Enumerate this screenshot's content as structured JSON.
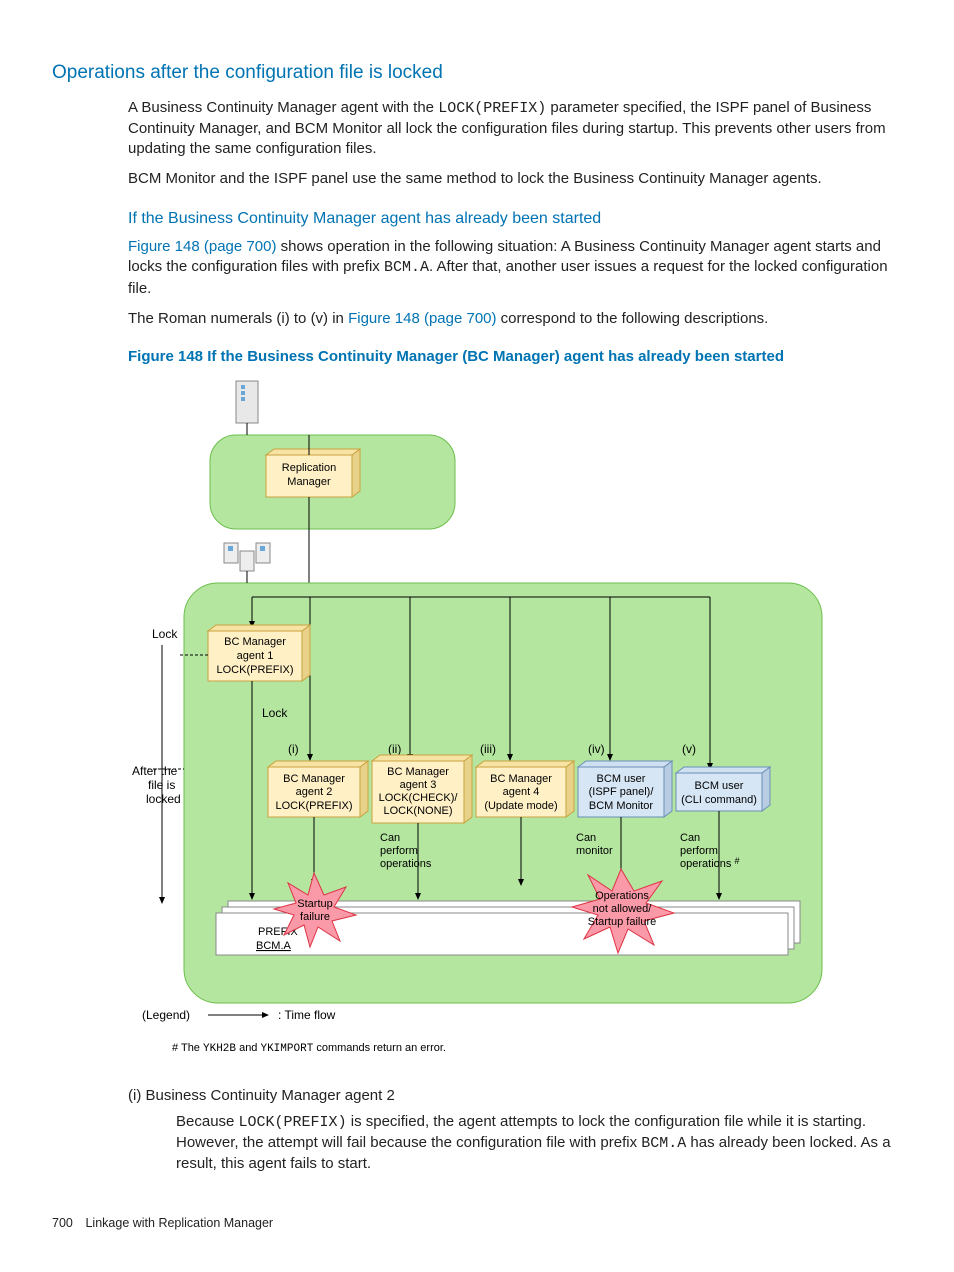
{
  "h2": "Operations after the configuration file is locked",
  "p1_a": "A Business Continuity Manager agent with the ",
  "p1_code": "LOCK(PREFIX)",
  "p1_b": " parameter specified, the ISPF panel of Business Continuity Manager, and BCM Monitor all lock the configuration files during startup. This prevents other users from updating the same configuration files.",
  "p2": "BCM Monitor and the ISPF panel use the same method to lock the Business Continuity Manager agents.",
  "h3": "If the Business Continuity Manager agent has already been started",
  "p3_link": "Figure 148 (page 700)",
  "p3_a": " shows operation in the following situation: A Business Continuity Manager agent starts and locks the configuration files with prefix ",
  "p3_code": "BCM.A",
  "p3_b": ". After that, another user issues a request for the locked configuration file.",
  "p4_a": "The Roman numerals (i) to (v) in ",
  "p4_link": "Figure 148 (page 700)",
  "p4_b": " correspond to the following descriptions.",
  "fig_caption": "Figure 148 If the Business Continuity Manager (BC Manager) agent has already been started",
  "diagram": {
    "repmgr": "Replication\nManager",
    "lock": "Lock",
    "after": "After the\nfile is\nlocked",
    "agent1": "BC Manager\nagent 1\nLOCK(PREFIX)",
    "agent2": "BC Manager\nagent 2\nLOCK(PREFIX)",
    "agent3": "BC Manager\nagent 3\nLOCK(CHECK)/\nLOCK(NONE)",
    "agent4": "BC Manager\nagent 4\n(Update mode)",
    "user_ispf": "BCM user\n(ISPF panel)/\nBCM Monitor",
    "user_cli": "BCM user\n(CLI command)",
    "roman": [
      "(i)",
      "(ii)",
      "(iii)",
      "(iv)",
      "(v)"
    ],
    "can_perform": "Can\nperform\noperations",
    "can_monitor": "Can\nmonitor",
    "can_perform2": "Can\nperform\noperations #",
    "startup_fail": "Startup\nfailure",
    "not_allowed": "Operations\nnot allowed/\nStartup failure",
    "prefix": "PREFIX",
    "bcma": "BCM.A",
    "legend": "(Legend)",
    "timeflow": ": Time flow"
  },
  "footnote_a": "# The ",
  "footnote_c1": "YKH2B",
  "footnote_b": " and ",
  "footnote_c2": "YKIMPORT",
  "footnote_c": " commands return an error.",
  "li_head": "(i) Business Continuity Manager agent 2",
  "li_a": "Because ",
  "li_code1": "LOCK(PREFIX)",
  "li_b": " is specified, the agent attempts to lock the configuration file while it is starting. However, the attempt will fail because the configuration file with prefix ",
  "li_code2": "BCM.A",
  "li_c": " has already been locked. As a result, this agent fails to start.",
  "footer_page": "700",
  "footer_text": "Linkage with Replication Manager"
}
